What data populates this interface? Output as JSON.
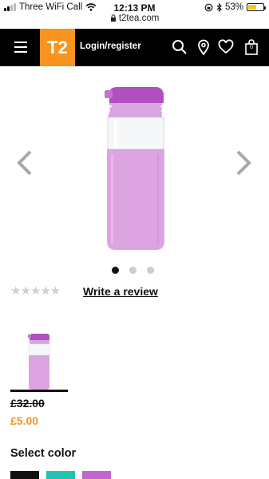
{
  "status_bar": {
    "carrier": "Three WiFi Call",
    "time": "12:13 PM",
    "battery": "53%",
    "battery_level": 0.53,
    "url": "t2tea.com"
  },
  "header": {
    "logo_text": "T2",
    "login_label": "Login/register",
    "bag_count": "0",
    "colors": {
      "background": "#000000",
      "logo": "#f7941d"
    }
  },
  "gallery": {
    "active_slide": 1,
    "slide_count": 3,
    "product_colors": {
      "sleeve": "#dca4e0",
      "lid": "#b14fc0"
    }
  },
  "rating": {
    "stars": "★★★★★",
    "review_link": "Write a review"
  },
  "price": {
    "original": "£32.00",
    "sale": "£5.00",
    "sale_color": "#f7941d"
  },
  "color_select": {
    "label": "Select color",
    "swatches": [
      "#111111",
      "#1ec4b0",
      "#c265d0"
    ]
  },
  "icons": [
    "menu-icon",
    "search-icon",
    "location-pin-icon",
    "heart-icon",
    "shopping-bag-icon",
    "chevron-left-icon",
    "chevron-right-icon"
  ]
}
